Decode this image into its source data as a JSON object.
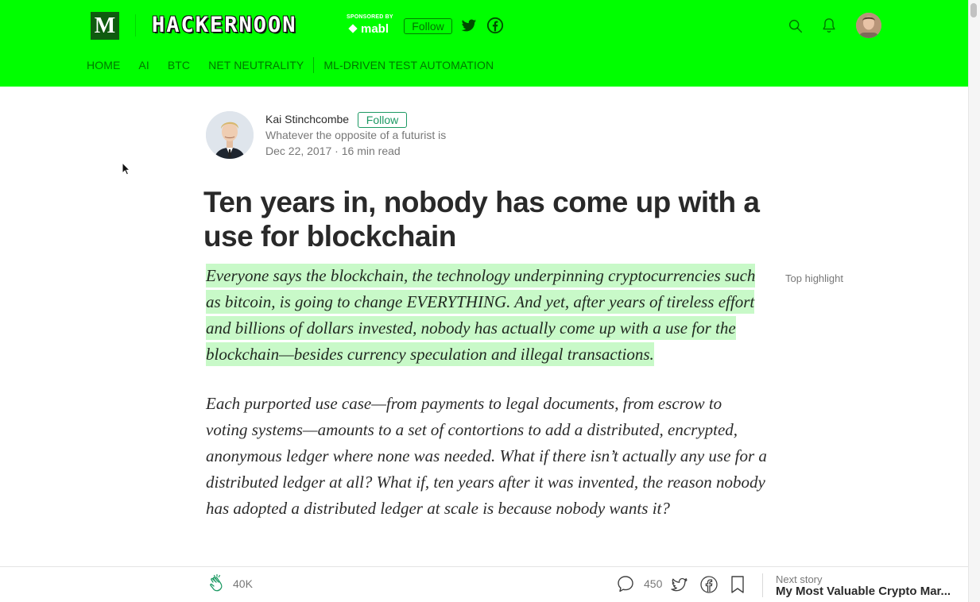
{
  "colors": {
    "header_bg": "#00ff00",
    "highlight": "#c8f9c8",
    "accent_green": "#1c9963"
  },
  "header": {
    "logo_letter": "M",
    "publication_name": "HACKERNOON",
    "sponsored_label": "SPONSORED BY",
    "sponsor_name": "mabl",
    "follow_label": "Follow",
    "icons": [
      "twitter-icon",
      "facebook-icon",
      "search-icon",
      "bell-icon",
      "avatar"
    ]
  },
  "nav": {
    "items": [
      {
        "label": "HOME"
      },
      {
        "label": "AI"
      },
      {
        "label": "BTC"
      },
      {
        "label": "NET NEUTRALITY"
      },
      {
        "label": "ML-DRIVEN TEST AUTOMATION"
      }
    ]
  },
  "author": {
    "name": "Kai Stinchcombe",
    "follow_label": "Follow",
    "bio": "Whatever the opposite of a futurist is",
    "date": "Dec 22, 2017",
    "read_time": "16 min read",
    "meta_separator": " · "
  },
  "article": {
    "title": "Ten years in, nobody has come up with a use for blockchain",
    "paragraph1": "Everyone says the blockchain, the technology underpinning cryptocurrencies such as bitcoin, is going to change EVERYTHING. And yet, after years of tireless effort and billions of dollars invested, nobody has actually come up with a use for the blockchain—besides currency speculation and illegal transactions.",
    "top_highlight_label": "Top highlight",
    "paragraph2": "Each purported use case—from payments to legal documents, from escrow to voting systems—amounts to a set of contortions to add a distributed, encrypted, anonymous ledger where none was needed. What if there isn’t actually any use for a distributed ledger at all? What if, ten years after it was invented, the reason nobody has adopted a distributed ledger at scale is because nobody wants it?"
  },
  "footer": {
    "clap_count": "40K",
    "response_count": "450",
    "next_story_label": "Next story",
    "next_story_title": "My Most Valuable Crypto Mar..."
  }
}
